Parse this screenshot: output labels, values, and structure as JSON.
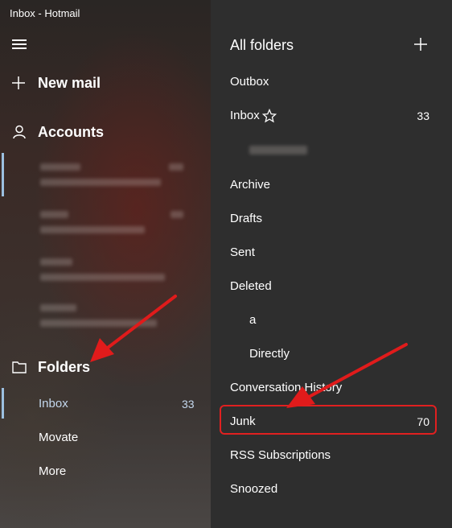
{
  "window": {
    "title": "Inbox - Hotmail"
  },
  "nav": {
    "new_mail": "New mail",
    "accounts": "Accounts",
    "folders": "Folders",
    "folder_items": [
      {
        "label": "Inbox",
        "count": "33"
      },
      {
        "label": "Movate"
      },
      {
        "label": "More"
      }
    ]
  },
  "folder_pane": {
    "title": "All folders",
    "items": [
      {
        "label": "Outbox"
      },
      {
        "label": "Inbox",
        "count": "33"
      },
      {
        "label": "Archive"
      },
      {
        "label": "Drafts"
      },
      {
        "label": "Sent"
      },
      {
        "label": "Deleted"
      },
      {
        "label": "a"
      },
      {
        "label": "Directly"
      },
      {
        "label": "Conversation History"
      },
      {
        "label": "Junk",
        "count": "70"
      },
      {
        "label": "RSS Subscriptions"
      },
      {
        "label": "Snoozed"
      }
    ]
  },
  "icons": [
    "hamburger-icon",
    "plus-icon",
    "person-icon",
    "folder-icon",
    "star-icon",
    "add-folder-icon"
  ],
  "colors": {
    "accent": "#9cc0e0",
    "annotation": "#e02020"
  }
}
